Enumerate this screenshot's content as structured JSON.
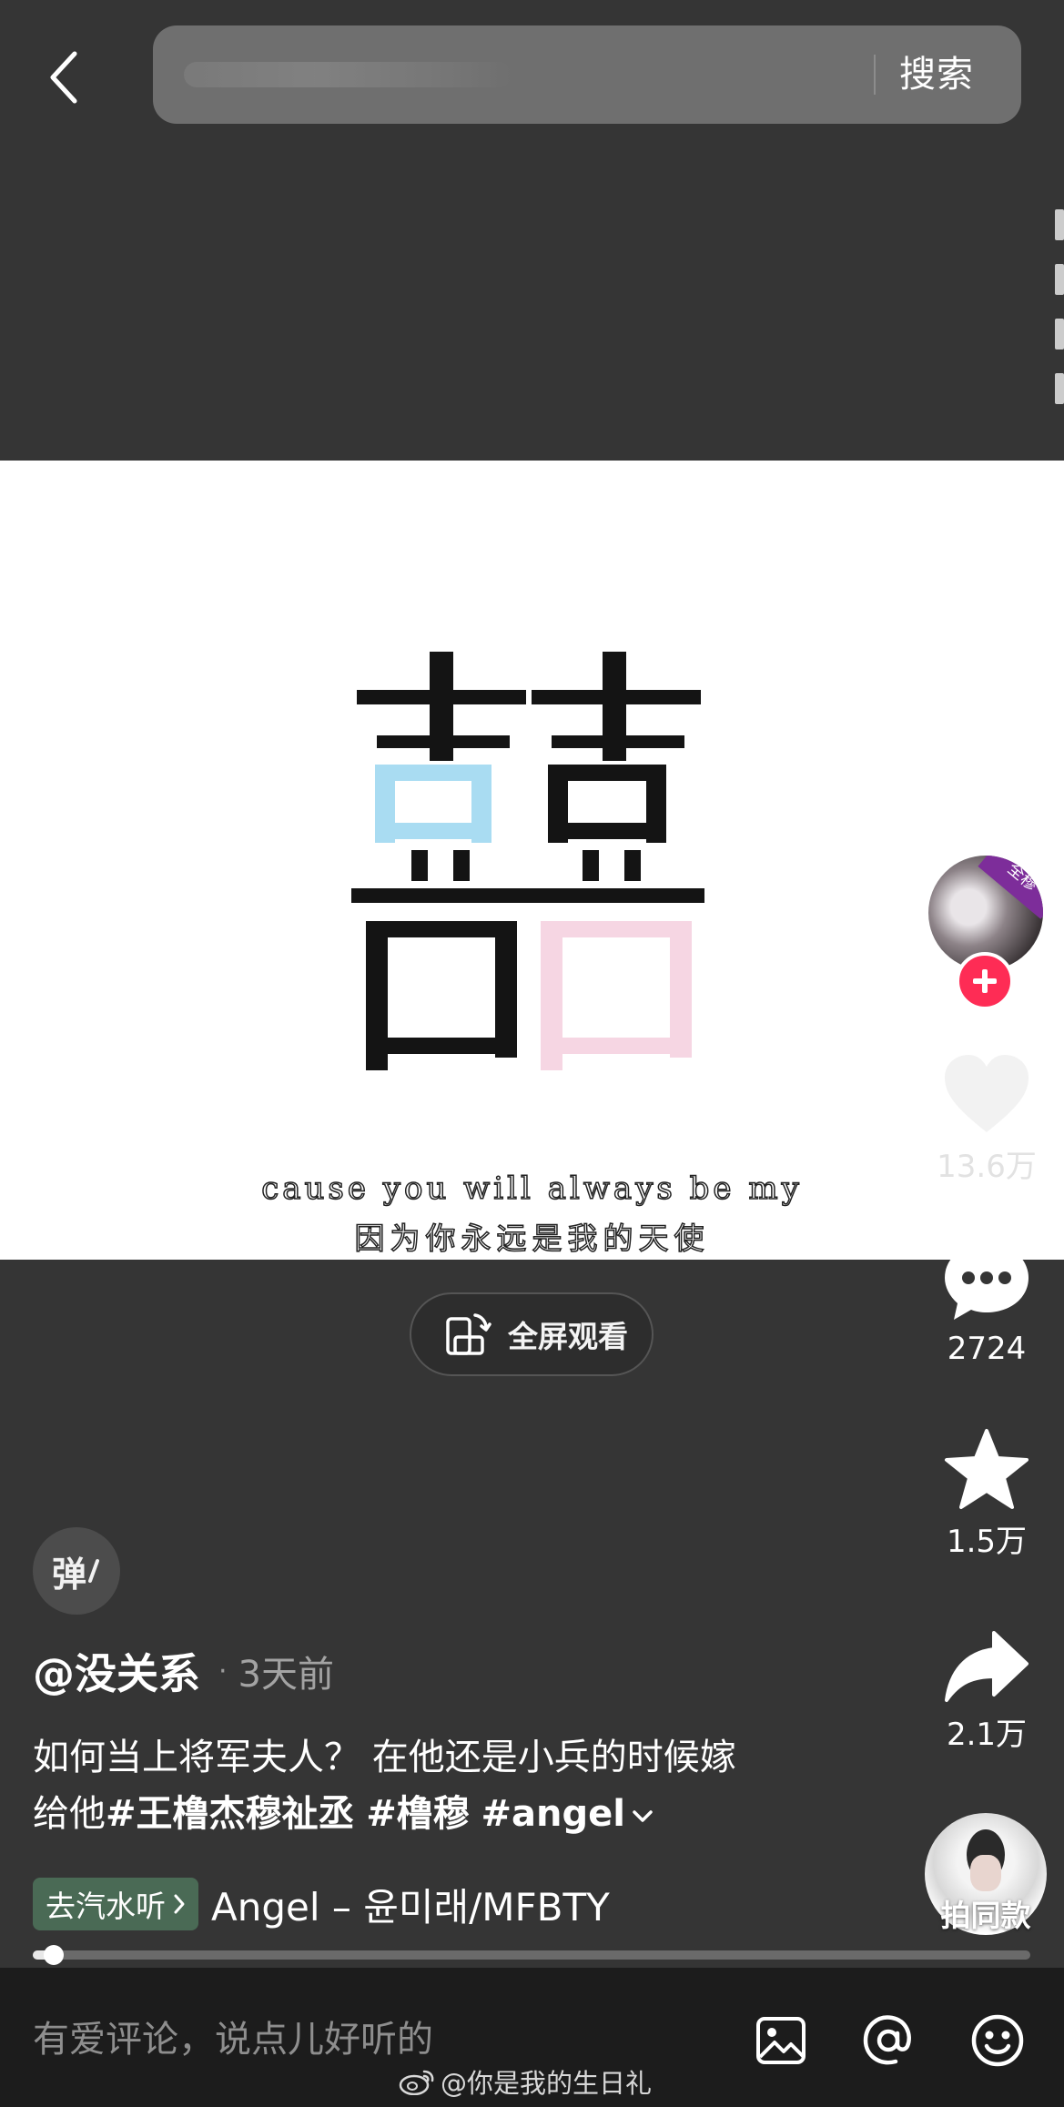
{
  "topbar": {
    "search_button_label": "搜索"
  },
  "video": {
    "subtitle_en": "cause you will always be my",
    "subtitle_zh": "因为你永远是我的天使"
  },
  "fullscreen": {
    "label": "全屏观看"
  },
  "rail": {
    "avatar_tag": "全穆",
    "likes": "13.6万",
    "comments": "2724",
    "favorites": "1.5万",
    "shares": "2.1万",
    "remix_label": "拍同款"
  },
  "danmaku": {
    "label": "弹"
  },
  "post": {
    "author": "@没关系",
    "time": "3天前",
    "description_line1": "如何当上将军夫人？ 在他还是小兵的时候嫁",
    "description_line2_prefix": "给他",
    "hashtags": [
      "#王橹杰穆祉丞",
      "#橹穆",
      "#angel"
    ]
  },
  "music": {
    "chip_label": "去汽水听",
    "title": "Angel – 윤미래/MFBTY"
  },
  "progress": {
    "fraction": 0.021
  },
  "comment_bar": {
    "placeholder": "有爱评论，说点儿好听的"
  },
  "watermark": {
    "text": "@你是我的生日礼"
  },
  "colors": {
    "accent_follow": "#fe2c55",
    "music_chip": "#4a6a55",
    "glyph_blue": "#a9dcf2",
    "glyph_pink": "#f6d6e3"
  }
}
